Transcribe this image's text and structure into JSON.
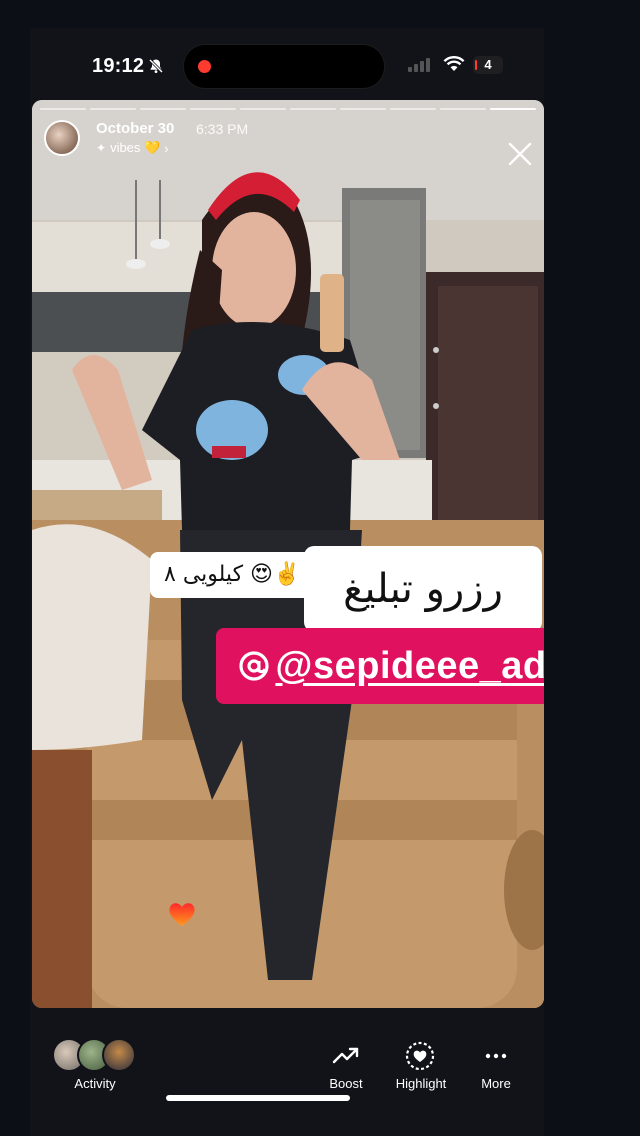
{
  "status_bar": {
    "time": "19:12",
    "battery": "4",
    "icons": [
      "bell-slash-icon",
      "signal-icon",
      "wifi-icon",
      "battery-icon"
    ]
  },
  "story": {
    "date": "October 30",
    "time": "6:33 PM",
    "music": "vibes 💛",
    "music_chevron": "›",
    "segments": 10,
    "active_segment_progress": 1,
    "calorie_sticker": "✌️😍 کیلویی ۸",
    "reserve_sticker": "رزرو تبلیغ",
    "mention": "@sepideee_ad",
    "colors": {
      "mention_bg": "#e0125f",
      "heart": "#ff4b1f"
    }
  },
  "bottom_bar": {
    "activity_label": "Activity",
    "boost_label": "Boost",
    "highlight_label": "Highlight",
    "more_label": "More"
  }
}
